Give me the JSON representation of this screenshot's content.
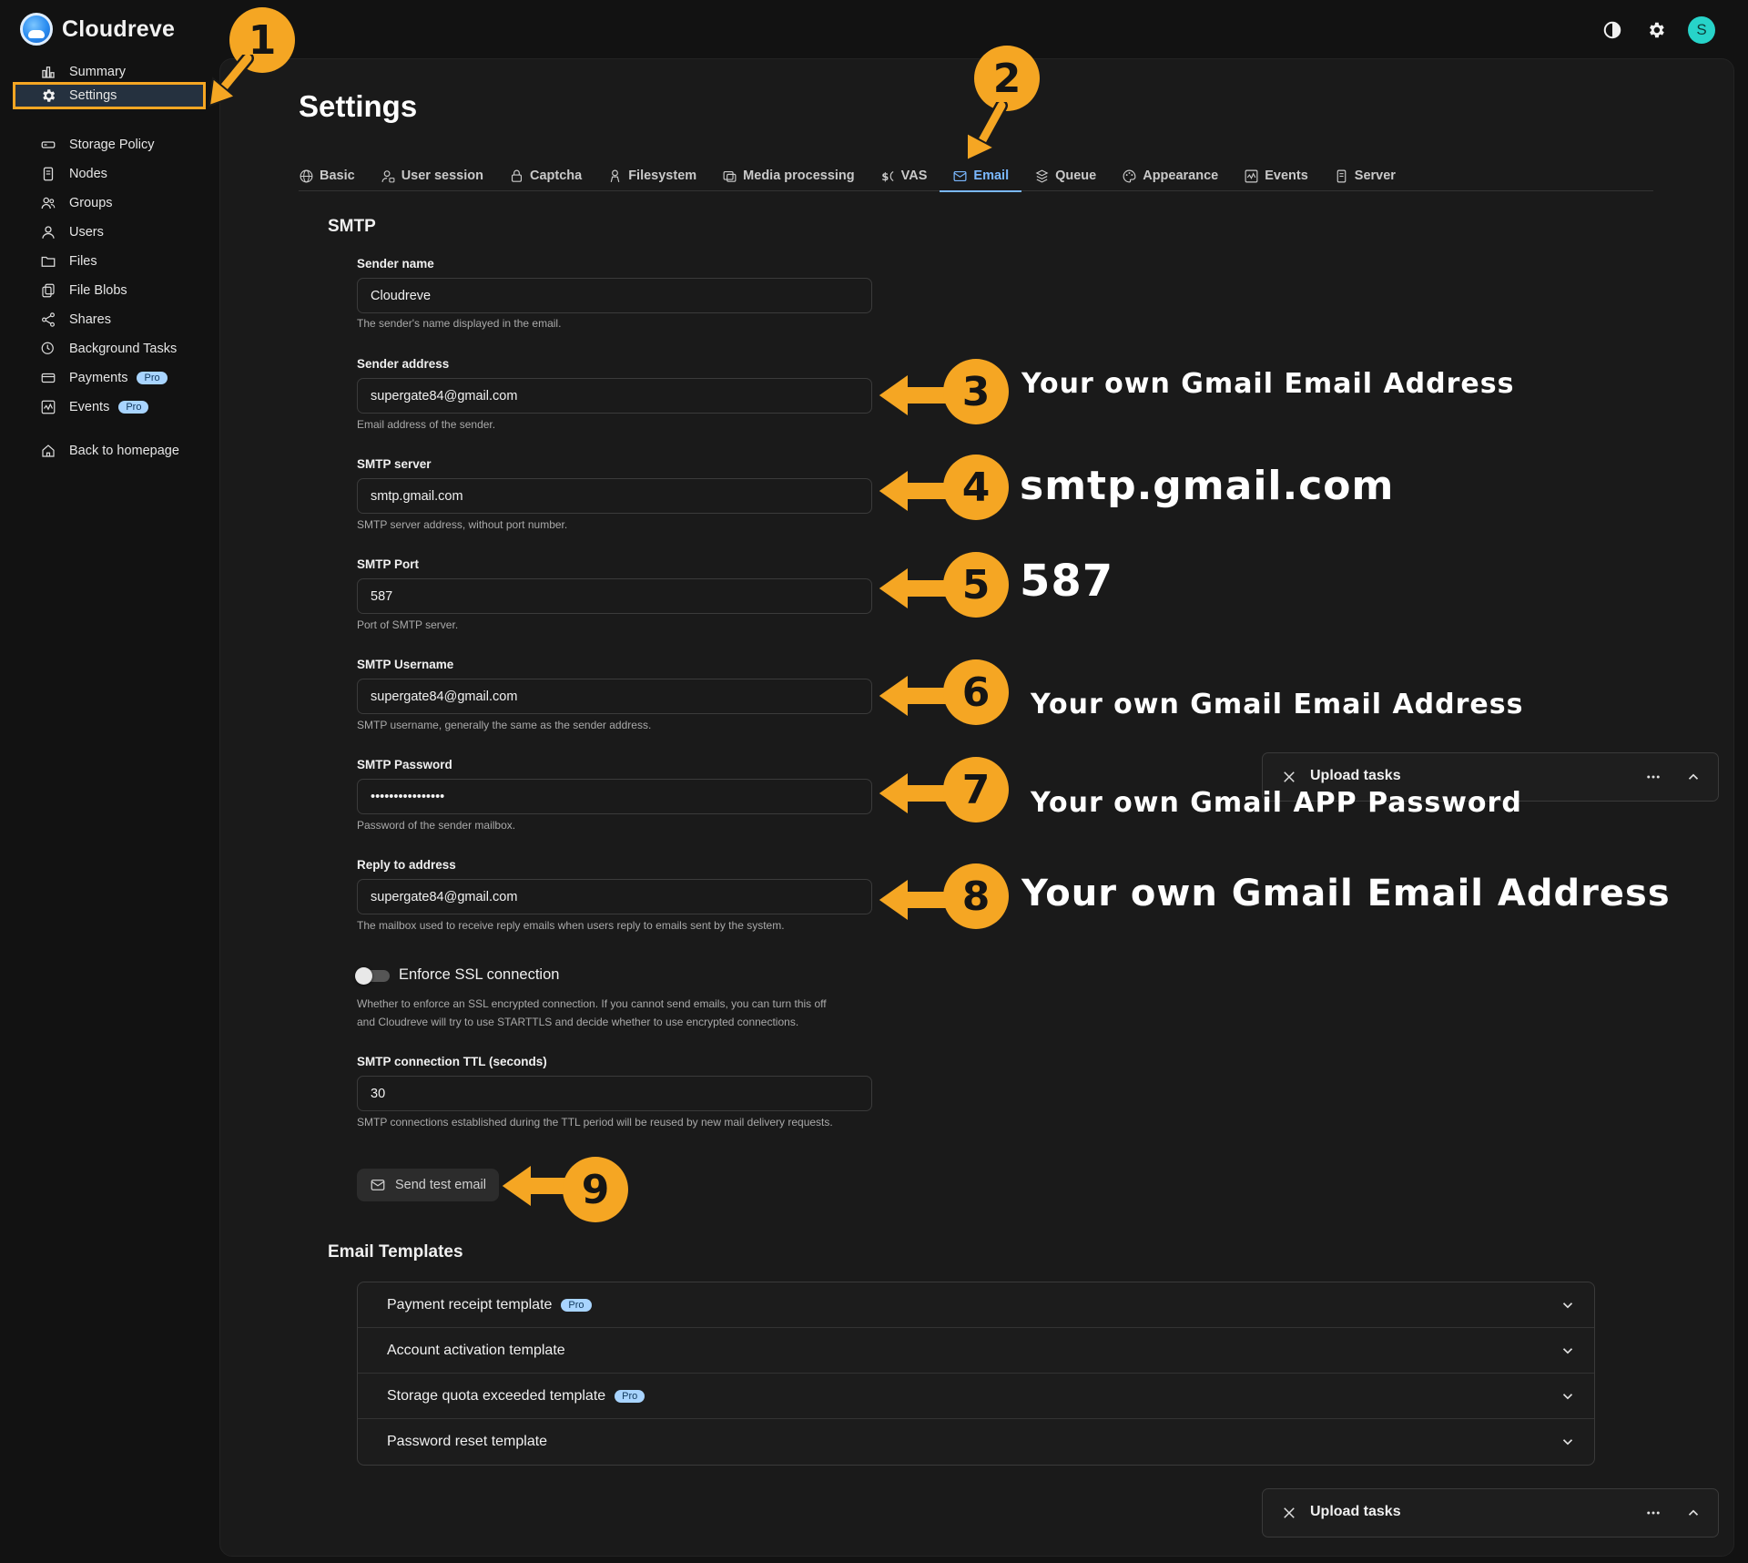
{
  "app": {
    "title": "Cloudreve",
    "avatar_initial": "S",
    "accent": "#7ab8ff",
    "annotation_color": "#f5a623"
  },
  "topbar": {
    "icons": [
      "theme-toggle-icon",
      "settings-gear-icon"
    ]
  },
  "sidebar": {
    "items": [
      {
        "label": "Summary",
        "icon": "chart-icon"
      },
      {
        "label": "Settings",
        "icon": "gear-icon",
        "active": true
      },
      {
        "label": "Storage Policy",
        "icon": "storage-icon"
      },
      {
        "label": "Nodes",
        "icon": "node-icon"
      },
      {
        "label": "Groups",
        "icon": "groups-icon"
      },
      {
        "label": "Users",
        "icon": "user-icon"
      },
      {
        "label": "Files",
        "icon": "folder-icon"
      },
      {
        "label": "File Blobs",
        "icon": "blob-icon"
      },
      {
        "label": "Shares",
        "icon": "share-icon"
      },
      {
        "label": "Background Tasks",
        "icon": "tasks-icon"
      },
      {
        "label": "Payments",
        "icon": "payment-icon",
        "badge": "Pro"
      },
      {
        "label": "Events",
        "icon": "events-icon",
        "badge": "Pro"
      },
      {
        "label": "Back to homepage",
        "icon": "home-icon"
      }
    ]
  },
  "page": {
    "title": "Settings"
  },
  "tabs": [
    {
      "label": "Basic",
      "icon": "globe-icon"
    },
    {
      "label": "User session",
      "icon": "user-session-icon"
    },
    {
      "label": "Captcha",
      "icon": "captcha-icon"
    },
    {
      "label": "Filesystem",
      "icon": "filesystem-icon"
    },
    {
      "label": "Media processing",
      "icon": "media-icon"
    },
    {
      "label": "VAS",
      "icon": "vas-icon"
    },
    {
      "label": "Email",
      "icon": "mail-icon",
      "active": true
    },
    {
      "label": "Queue",
      "icon": "queue-icon"
    },
    {
      "label": "Appearance",
      "icon": "palette-icon"
    },
    {
      "label": "Events",
      "icon": "events-icon"
    },
    {
      "label": "Server",
      "icon": "server-icon"
    }
  ],
  "smtp": {
    "section_title": "SMTP",
    "fields": [
      {
        "label": "Sender name",
        "value": "Cloudreve",
        "help": "The sender's name displayed in the email."
      },
      {
        "label": "Sender address",
        "value": "supergate84@gmail.com",
        "help": "Email address of the sender."
      },
      {
        "label": "SMTP server",
        "value": "smtp.gmail.com",
        "help": "SMTP server address, without port number."
      },
      {
        "label": "SMTP Port",
        "value": "587",
        "help": "Port of SMTP server."
      },
      {
        "label": "SMTP Username",
        "value": "supergate84@gmail.com",
        "help": "SMTP username, generally the same as the sender address."
      },
      {
        "label": "SMTP Password",
        "value": "••••••••••••••••",
        "help": "Password of the sender mailbox."
      },
      {
        "label": "Reply to address",
        "value": "supergate84@gmail.com",
        "help": "The mailbox used to receive reply emails when users reply to emails sent by the system."
      }
    ],
    "ssl": {
      "label": "Enforce SSL connection",
      "enabled": false,
      "help_line1": "Whether to enforce an SSL encrypted connection. If you cannot send emails, you can turn this off",
      "help_line2": "and Cloudreve will try to use STARTTLS and decide whether to use encrypted connections."
    },
    "ttl": {
      "label": "SMTP connection TTL (seconds)",
      "value": "30",
      "help": "SMTP connections established during the TTL period will be reused by new mail delivery requests."
    },
    "test_button": "Send test email"
  },
  "templates": {
    "section_title": "Email Templates",
    "items": [
      {
        "label": "Payment receipt template",
        "badge": "Pro"
      },
      {
        "label": "Account activation template"
      },
      {
        "label": "Storage quota exceeded template",
        "badge": "Pro"
      },
      {
        "label": "Password reset template"
      }
    ]
  },
  "upload_tasks": {
    "title": "Upload tasks"
  },
  "annotations": {
    "numbers": [
      "1",
      "2",
      "3",
      "4",
      "5",
      "6",
      "7",
      "8",
      "9"
    ],
    "texts": {
      "a3": "Your own Gmail Email Address",
      "a4": "smtp.gmail.com",
      "a5": "587",
      "a6": "Your own Gmail Email Address",
      "a7": "Your own Gmail APP Password",
      "a8": "Your own Gmail Email Address"
    }
  }
}
